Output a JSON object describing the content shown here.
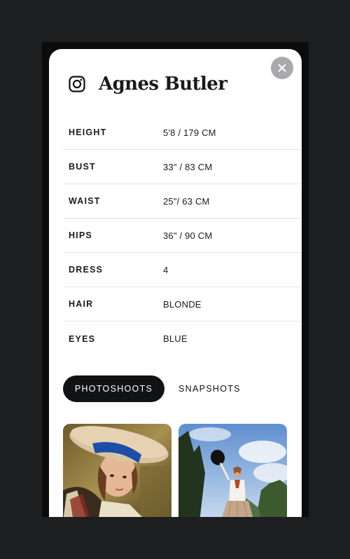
{
  "profile": {
    "name": "Agnes Butler",
    "social_icon": "instagram-icon",
    "close_icon": "close-icon"
  },
  "stats": [
    {
      "label": "HEIGHT",
      "value": "5'8 / 179 CM"
    },
    {
      "label": "BUST",
      "value": "33\" / 83 CM"
    },
    {
      "label": "WAIST",
      "value": "25\"/ 63 CM"
    },
    {
      "label": "HIPS",
      "value": "36\" / 90 CM"
    },
    {
      "label": "DRESS",
      "value": "4"
    },
    {
      "label": "HAIR",
      "value": "BLONDE"
    },
    {
      "label": "EYES",
      "value": "BLUE"
    }
  ],
  "tabs": [
    {
      "label": "PHOTOSHOOTS",
      "active": true
    },
    {
      "label": "SNAPSHOTS",
      "active": false
    }
  ],
  "colors": {
    "page_background": "#1d1e20",
    "sheet_background": "#ffffff",
    "active_tab": "#111214",
    "close_button": "#a9a9ab"
  }
}
